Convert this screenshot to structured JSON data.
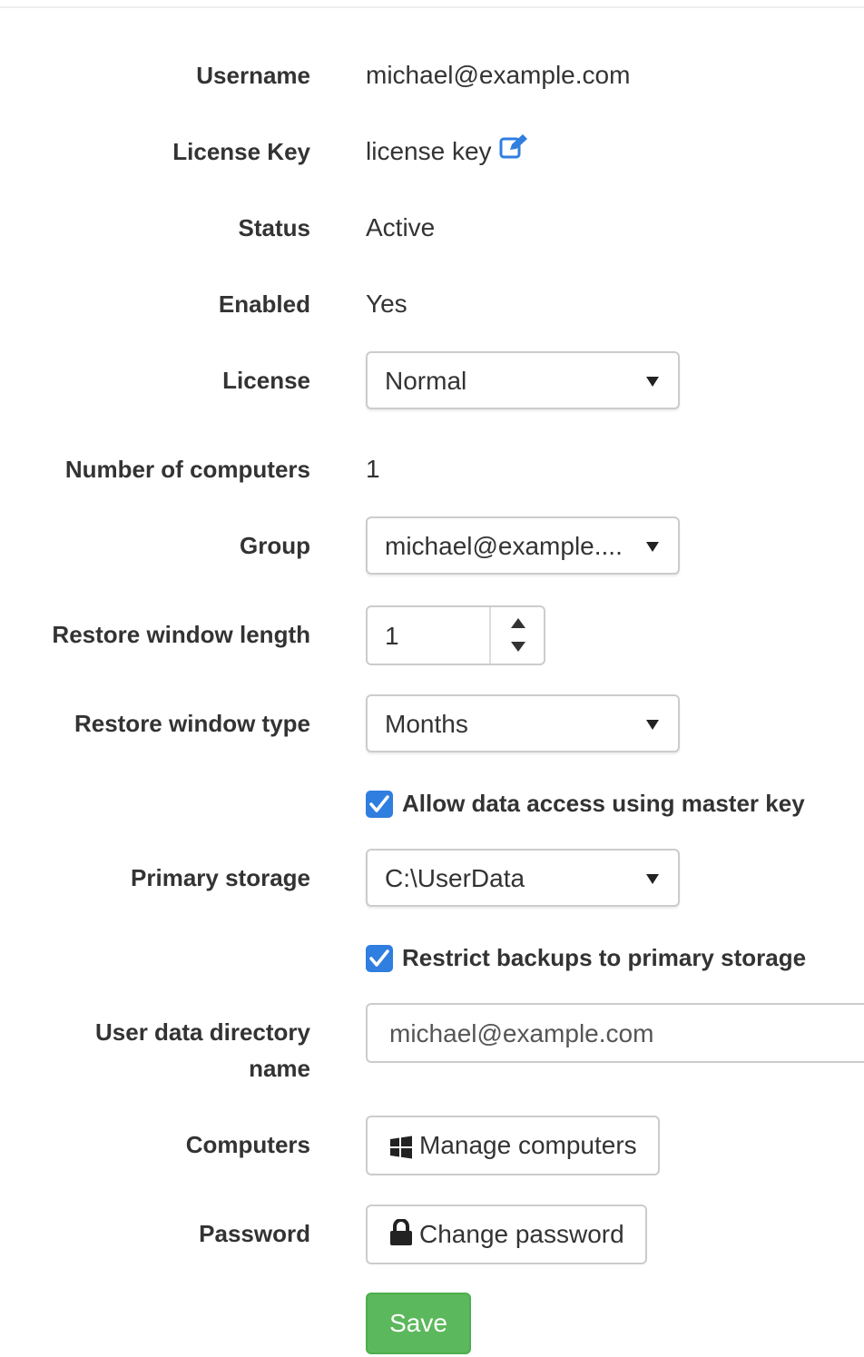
{
  "fields": {
    "username": {
      "label": "Username",
      "value": "michael@example.com"
    },
    "license_key": {
      "label": "License Key",
      "value": "license key",
      "icon": "edit-icon"
    },
    "status": {
      "label": "Status",
      "value": "Active"
    },
    "enabled": {
      "label": "Enabled",
      "value": "Yes"
    },
    "license": {
      "label": "License",
      "selected": "Normal"
    },
    "num_computers": {
      "label": "Number of computers",
      "value": "1"
    },
    "group": {
      "label": "Group",
      "selected": "michael@example...."
    },
    "restore_window_length": {
      "label": "Restore window length",
      "value": "1"
    },
    "restore_window_type": {
      "label": "Restore window type",
      "selected": "Months"
    },
    "allow_master_key": {
      "label": "Allow data access using master key",
      "checked": true
    },
    "primary_storage": {
      "label": "Primary storage",
      "selected": "C:\\UserData"
    },
    "restrict_backups": {
      "label": "Restrict backups to primary storage",
      "checked": true
    },
    "user_data_dir": {
      "label_line1": "User data directory",
      "label_line2": "name",
      "value": "michael@example.com"
    },
    "computers": {
      "label": "Computers",
      "button": "Manage computers",
      "icon": "windows-icon"
    },
    "password": {
      "label": "Password",
      "button": "Change password",
      "icon": "lock-icon"
    }
  },
  "actions": {
    "save_label": "Save"
  },
  "colors": {
    "checkbox": "#2f7ee0",
    "edit_icon": "#2f7ee0",
    "save_button": "#5cb85c"
  }
}
